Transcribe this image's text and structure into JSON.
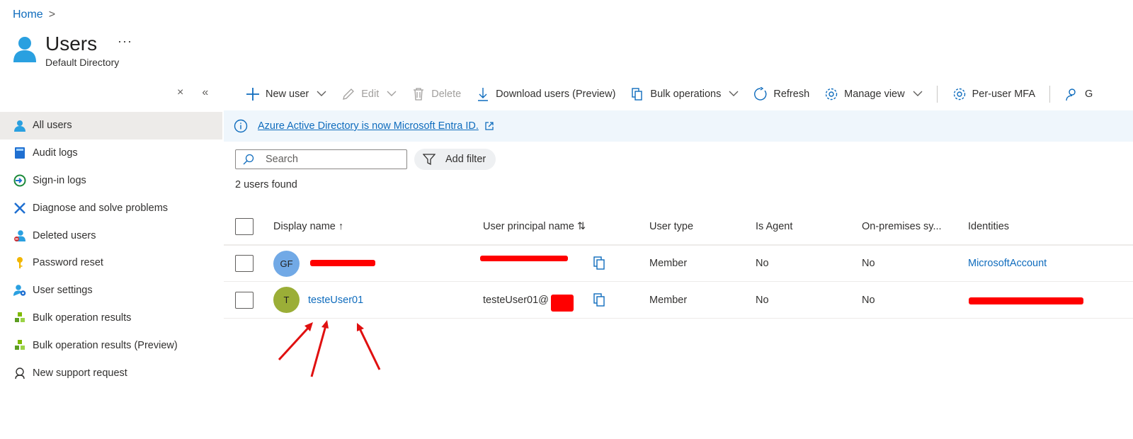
{
  "breadcrumb": {
    "home": "Home",
    "separator": ">"
  },
  "header": {
    "title": "Users",
    "subtitle": "Default Directory",
    "more": "···"
  },
  "side_controls": {
    "close": "×",
    "collapse": "«"
  },
  "sidebar": {
    "items": [
      {
        "label": "All users",
        "icon": "user-icon",
        "active": true
      },
      {
        "label": "Audit logs",
        "icon": "book-icon"
      },
      {
        "label": "Sign-in logs",
        "icon": "sign-in-icon"
      },
      {
        "label": "Diagnose and solve problems",
        "icon": "wrench-icon"
      },
      {
        "label": "Deleted users",
        "icon": "user-deleted-icon"
      },
      {
        "label": "Password reset",
        "icon": "key-icon"
      },
      {
        "label": "User settings",
        "icon": "user-settings-icon"
      },
      {
        "label": "Bulk operation results",
        "icon": "cubes-icon"
      },
      {
        "label": "Bulk operation results (Preview)",
        "icon": "cubes-icon"
      },
      {
        "label": "New support request",
        "icon": "support-icon"
      }
    ]
  },
  "toolbar": {
    "new_user": "New user",
    "edit": "Edit",
    "delete": "Delete",
    "download": "Download users (Preview)",
    "bulk": "Bulk operations",
    "refresh": "Refresh",
    "manage_view": "Manage view",
    "per_user_mfa": "Per-user MFA",
    "truncated": "G"
  },
  "banner": {
    "text": "Azure Active Directory is now Microsoft Entra ID."
  },
  "search": {
    "placeholder": "Search"
  },
  "filter": {
    "label": "Add filter"
  },
  "result_count": "2 users found",
  "table": {
    "columns": {
      "display_name": "Display name ↑",
      "upn": "User principal name ⇅",
      "user_type": "User type",
      "is_agent": "Is Agent",
      "onprem": "On-premises sy...",
      "identities": "Identities"
    },
    "rows": [
      {
        "initials": "GF",
        "avatar_color": "#71a9e6",
        "display_name": "",
        "upn": "",
        "user_type": "Member",
        "is_agent": "No",
        "onprem": "No",
        "identities": "MicrosoftAccount"
      },
      {
        "initials": "T",
        "avatar_color": "#9bae37",
        "display_name": "testeUser01",
        "upn": "testeUser01@",
        "user_type": "Member",
        "is_agent": "No",
        "onprem": "No",
        "identities": ""
      }
    ]
  },
  "colors": {
    "link": "#0f6cbd",
    "banner_bg": "#eff6fc",
    "active_bg": "#edebe9",
    "redaction": "#ff0000"
  }
}
